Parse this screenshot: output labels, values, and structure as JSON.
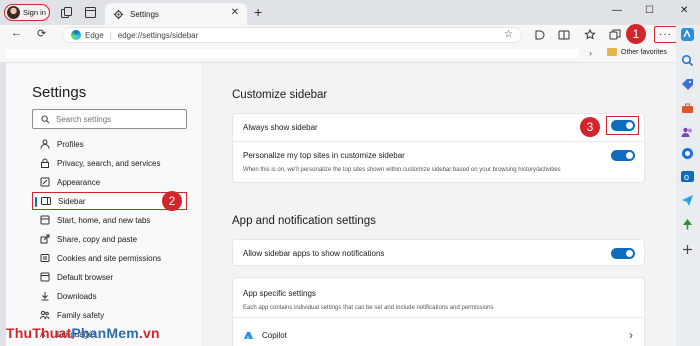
{
  "tabbar": {
    "signin_label": "Sign in",
    "tab_title": "Settings",
    "new_tab": "+",
    "tab_close": "✕",
    "window_controls": [
      "—",
      "☐",
      "✕"
    ]
  },
  "toolbar": {
    "back": "←",
    "refresh": "⟳",
    "brand": "Edge",
    "separator": "|",
    "url": "edge://settings/sidebar",
    "more": "···",
    "favorites_chevron": "›",
    "other_favorites": "Other favorites"
  },
  "nav": {
    "title": "Settings",
    "search_placeholder": "Search settings",
    "items": [
      {
        "label": "Profiles",
        "icon": "person-icon"
      },
      {
        "label": "Privacy, search, and services",
        "icon": "lock-icon"
      },
      {
        "label": "Appearance",
        "icon": "brush-icon"
      },
      {
        "label": "Sidebar",
        "icon": "sidebar-icon"
      },
      {
        "label": "Start, home, and new tabs",
        "icon": "home-icon"
      },
      {
        "label": "Share, copy and paste",
        "icon": "share-icon"
      },
      {
        "label": "Cookies and site permissions",
        "icon": "shield-icon"
      },
      {
        "label": "Default browser",
        "icon": "browser-icon"
      },
      {
        "label": "Downloads",
        "icon": "download-icon"
      },
      {
        "label": "Family safety",
        "icon": "family-icon"
      },
      {
        "label": "Languages",
        "icon": "language-icon"
      }
    ]
  },
  "content": {
    "section1_title": "Customize sidebar",
    "always_show": "Always show sidebar",
    "personalize_title": "Personalize my top sites in customize sidebar",
    "personalize_desc": "When this is on, we'll personalize the top sites shown within customize sidebar based on your browsing history/activities",
    "section2_title": "App and notification settings",
    "allow_notifications": "Allow sidebar apps to show notifications",
    "app_specific_title": "App specific settings",
    "app_specific_desc": "Each app contains individual settings that can be set and include notifications and permissions",
    "copilot": "Copilot",
    "chevron": "›"
  },
  "badges": [
    "1",
    "2",
    "3"
  ],
  "watermark": {
    "part1": "ThuThuat",
    "part2": "PhanMem",
    "part3": ".vn"
  },
  "colors": {
    "accent": "#0f6cbd",
    "highlight": "#d3262c"
  }
}
